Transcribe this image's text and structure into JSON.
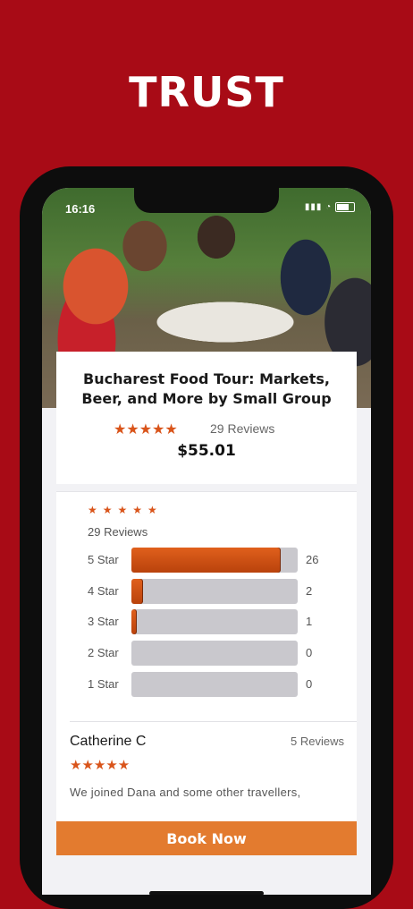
{
  "headline": "TRUST",
  "status_bar": {
    "time": "16:16"
  },
  "tour": {
    "title": "Bucharest Food Tour: Markets, Beer, and More by Small Group",
    "rating_stars": "★★★★★",
    "reviews_label": "29 Reviews",
    "price": "$55.01"
  },
  "reviews_summary": {
    "stars": "★★★★★",
    "count_label": "29 Reviews",
    "breakdown": [
      {
        "label": "5 Star",
        "count": 26,
        "fraction": 0.897
      },
      {
        "label": "4 Star",
        "count": 2,
        "fraction": 0.069
      },
      {
        "label": "3 Star",
        "count": 1,
        "fraction": 0.034
      },
      {
        "label": "2 Star",
        "count": 0,
        "fraction": 0
      },
      {
        "label": "1 Star",
        "count": 0,
        "fraction": 0
      }
    ]
  },
  "review": {
    "author": "Catherine C",
    "author_reviews": "5 Reviews",
    "stars": "★★★★★",
    "text": "We joined Dana and some other travellers,"
  },
  "cta": {
    "book_label": "Book Now"
  },
  "colors": {
    "brand_red": "#a80b16",
    "accent_orange": "#e37b2f",
    "star_orange": "#d9541a"
  },
  "icons": [
    "signal-icon",
    "wifi-icon",
    "battery-icon",
    "star-icon"
  ]
}
